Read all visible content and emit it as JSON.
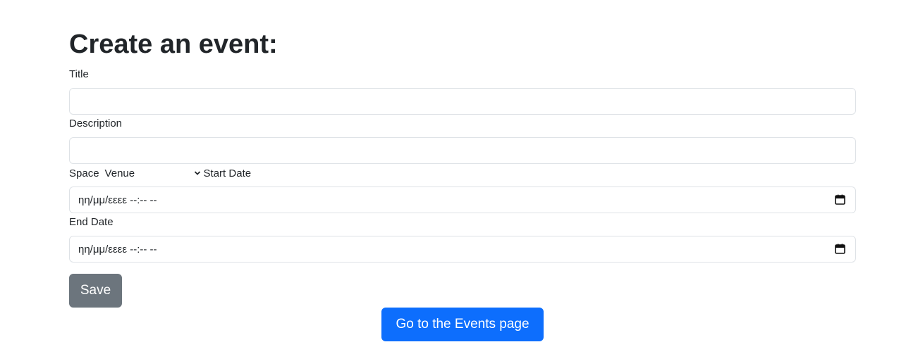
{
  "page": {
    "title": "Create an event:"
  },
  "form": {
    "title_label": "Title",
    "title_value": "",
    "description_label": "Description",
    "description_value": "",
    "space_label": "Space",
    "space_select_value": "Venue",
    "start_date_label": "Start Date",
    "start_date_value": "ηη/μμ/εεεε --:-- --",
    "end_date_label": "End Date",
    "end_date_value": "ηη/μμ/εεεε --:-- --",
    "save_label": "Save"
  },
  "nav": {
    "events_link_label": "Go to the Events page"
  },
  "icons": {
    "calendar": "calendar-icon",
    "chevron": "chevron-down-icon"
  },
  "colors": {
    "save_button": "#6c757d",
    "events_button": "#0d6efd",
    "input_border": "#dee2e6",
    "text": "#212529"
  }
}
